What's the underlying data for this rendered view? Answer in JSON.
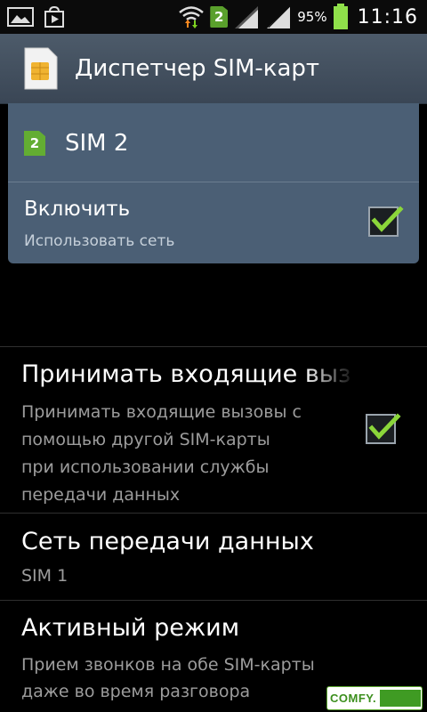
{
  "status_bar": {
    "sim_badge": "2",
    "battery": "95%",
    "time": "11:16"
  },
  "header": {
    "title": "Диспетчер SIM-карт"
  },
  "sim_panel": {
    "badge": "2",
    "name": "SIM 2",
    "enable_title": "Включить",
    "enable_sub": "Использовать сеть",
    "enabled": true
  },
  "settings": {
    "incoming": {
      "title": "Принимать входящие выз",
      "sub_lines": [
        "Принимать входящие вызовы с",
        "помощью другой SIM-карты",
        "при использовании службы",
        "передачи данных"
      ],
      "checked": true
    },
    "data_network": {
      "title": "Сеть передачи данных",
      "value": "SIM 1"
    },
    "active_mode": {
      "title": "Активный режим",
      "sub_lines": [
        "Прием звонков на обе SIM-карты",
        "даже во время разговора"
      ]
    }
  },
  "watermark": {
    "text": "COMFY."
  },
  "colors": {
    "accent_green": "#63ad32",
    "panel_blue": "#4b5f75",
    "checkmark": "#8bd63a"
  }
}
